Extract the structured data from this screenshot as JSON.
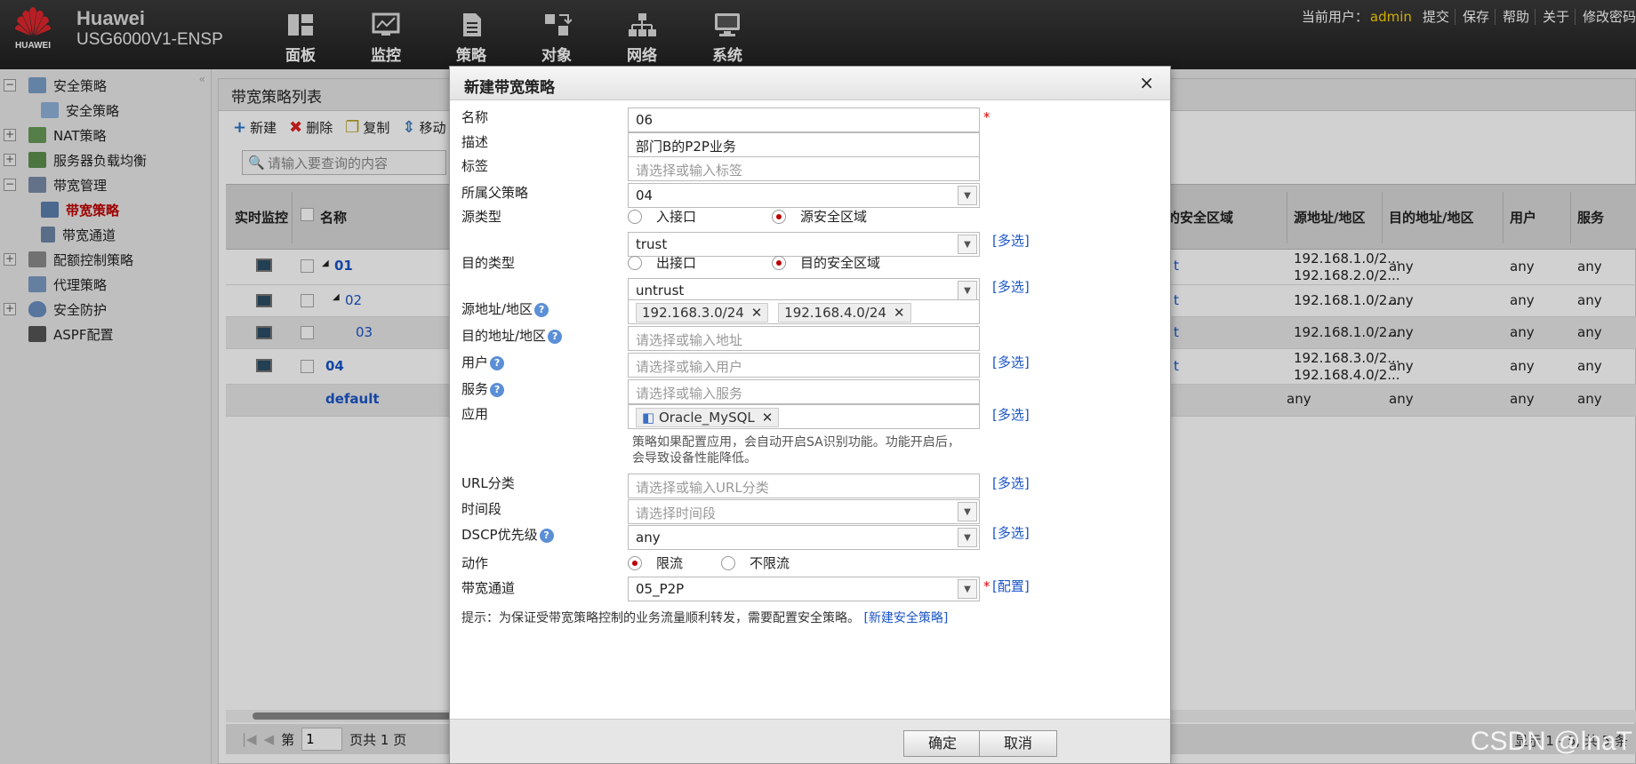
{
  "header": {
    "logo_text": "HUAWEI",
    "brand": "Huawei",
    "model": "USG6000V1-ENSP",
    "nav": [
      "面板",
      "监控",
      "策略",
      "对象",
      "网络",
      "系统"
    ],
    "current_user_label": "当前用户：",
    "current_user": "admin",
    "links": [
      "提交",
      "保存",
      "帮助",
      "关于",
      "修改密码"
    ]
  },
  "sidebar": {
    "items": [
      {
        "label": "安全策略",
        "expander": "−"
      },
      {
        "label": "安全策略"
      },
      {
        "label": "NAT策略",
        "expander": "+"
      },
      {
        "label": "服务器负载均衡",
        "expander": "+"
      },
      {
        "label": "带宽管理",
        "expander": "−"
      },
      {
        "label": "带宽策略"
      },
      {
        "label": "带宽通道"
      },
      {
        "label": "配额控制策略",
        "expander": "+"
      },
      {
        "label": "代理策略"
      },
      {
        "label": "安全防护",
        "expander": "+"
      },
      {
        "label": "ASPF配置"
      }
    ]
  },
  "main": {
    "title": "带宽策略列表",
    "toolbar": [
      "新建",
      "删除",
      "复制",
      "移动"
    ],
    "search_placeholder": "请输入要查询的内容",
    "columns": [
      "实时监控",
      "名称",
      "的安全区域",
      "源地址/地区",
      "目的地址/地区",
      "用户",
      "服务"
    ],
    "rows": [
      {
        "name": "01",
        "zone": "t",
        "src1": "192.168.1.0/2...",
        "src2": "192.168.2.0/2...",
        "dst": "any",
        "user": "any",
        "svc": "any"
      },
      {
        "name": "02",
        "zone": "t",
        "src1": "192.168.1.0/2...",
        "src2": "",
        "dst": "any",
        "user": "any",
        "svc": "any"
      },
      {
        "name": "03",
        "zone": "t",
        "src1": "192.168.1.0/2...",
        "src2": "",
        "dst": "any",
        "user": "any",
        "svc": "any"
      },
      {
        "name": "04",
        "zone": "t",
        "src1": "192.168.3.0/2...",
        "src2": "192.168.4.0/2...",
        "dst": "any",
        "user": "any",
        "svc": "any"
      },
      {
        "name": "default",
        "zone": "",
        "src1": "any",
        "src2": "",
        "dst": "any",
        "user": "any",
        "svc": "any"
      }
    ],
    "pager": {
      "page_prefix": "第",
      "page": "1",
      "page_suffix": "页共 1 页",
      "summary": "显示 1 - 5, 共 5 条"
    }
  },
  "modal": {
    "title": "新建带宽策略",
    "close": "×",
    "labels": {
      "name": "名称",
      "desc": "描述",
      "tag": "标签",
      "parent": "所属父策略",
      "src_type": "源类型",
      "dst_type": "目的类型",
      "src_addr": "源地址/地区",
      "dst_addr": "目的地址/地区",
      "user": "用户",
      "service": "服务",
      "app": "应用",
      "url": "URL分类",
      "time": "时间段",
      "dscp": "DSCP优先级",
      "action": "动作",
      "channel": "带宽通道"
    },
    "values": {
      "name": "06",
      "desc": "部门B的P2P业务",
      "tag_placeholder": "请选择或输入标签",
      "parent": "04",
      "src_zone": "trust",
      "dst_zone": "untrust",
      "src_addr_tags": [
        "192.168.3.0/24",
        "192.168.4.0/24"
      ],
      "dst_addr_placeholder": "请选择或输入地址",
      "user_placeholder": "请选择或输入用户",
      "service_placeholder": "请选择或输入服务",
      "app_tag": "Oracle_MySQL",
      "url_placeholder": "请选择或输入URL分类",
      "time_placeholder": "请选择时间段",
      "dscp": "any",
      "channel": "05_P2P"
    },
    "radio": {
      "src_iface": "入接口",
      "src_zone": "源安全区域",
      "dst_iface": "出接口",
      "dst_zone": "目的安全区域",
      "limit": "限流",
      "nolimit": "不限流"
    },
    "multi_select": "[多选]",
    "config_link": "[配置]",
    "app_note": "策略如果配置应用，会自动开启SA识别功能。功能开启后，会导致设备性能降低。",
    "tip_text": "提示：为保证受带宽策略控制的业务流量顺利转发，需要配置安全策略。",
    "tip_link": "[新建安全策略]",
    "ok": "确定",
    "cancel": "取消"
  },
  "watermark": "CSDN @lnaT",
  "colors": {
    "accent": "#1a55c7",
    "active": "#c00000",
    "user": "#ffd400"
  }
}
